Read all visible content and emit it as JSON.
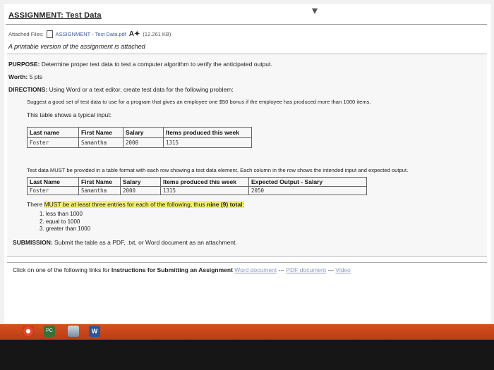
{
  "assignment": {
    "title": "ASSIGNMENT: Test Data",
    "attached_label": "Attached Files:",
    "file_name": "ASSIGNMENT - Test Data.pdf",
    "file_size": "(12.261 KB)",
    "description": "A printable version of the assignment is attached"
  },
  "purpose": {
    "label": "PURPOSE:",
    "text": "Determine proper test data to test a computer algorithm to verify the anticipated output."
  },
  "worth": {
    "label": "Worth:",
    "text": "5 pts"
  },
  "directions": {
    "label": "DIRECTIONS:",
    "text": "Using Word or a text editor, create test data for the following problem:",
    "problem": "Suggest a good set of test data to use for a program that gives an employee one $50 bonus if the employee has produced more than 1000 items.",
    "table_intro": "This table shows a typical input:"
  },
  "table1": {
    "headers": [
      "Last name",
      "First Name",
      "Salary",
      "Items produced this week"
    ],
    "row": [
      "Foster",
      "Samantha",
      "2000",
      "1315"
    ]
  },
  "instructions": "Test data MUST be provided in a table format with each row showing a test data element. Each column in the row shows the intended input and expected output.",
  "table2": {
    "headers": [
      "Last Name",
      "First Name",
      "Salary",
      "Items produced this week",
      "Expected Output - Salary"
    ],
    "row": [
      "Foster",
      "Samantha",
      "2000",
      "1315",
      "2050"
    ]
  },
  "requirement": {
    "prefix": "There ",
    "emphasis": "MUST be at least three entries for each of the following, thus ",
    "bold": "nine (9) total",
    "suffix": ":"
  },
  "cases": [
    "1. less than 1000",
    "2. equal to 1000",
    "3. greater than 1000"
  ],
  "submission": {
    "label": "SUBMISSION:",
    "text": "Submit the table as a PDF, .txt, or Word document as an attachment."
  },
  "footer": {
    "text": "Click on one of the following links for ",
    "bold": "Instructions for Submitting an Assignment",
    "link_word": "Word document",
    "sep1": " --- ",
    "link_pdf": "PDF document",
    "sep2": " --- ",
    "link_video": "Video"
  },
  "taskbar": {
    "icons": [
      "chrome-icon",
      "pc-icon",
      "file-explorer-icon",
      "word-icon"
    ],
    "pc_label": "PC",
    "word_label": "W"
  },
  "colors": {
    "taskbar": "#c8461a",
    "highlight": "#f2f06a",
    "link": "#8a9cc9"
  }
}
